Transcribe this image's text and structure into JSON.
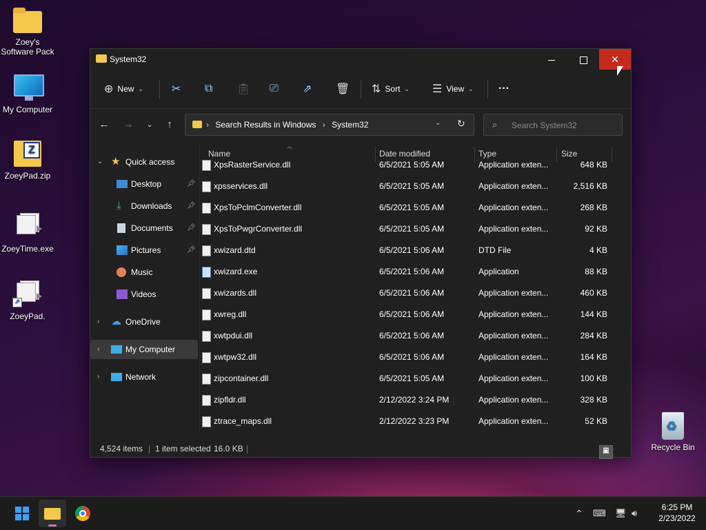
{
  "desktop": {
    "icons": [
      {
        "label": "Zoey's Software Pack",
        "icon": "folder-icon"
      },
      {
        "label": "My Computer",
        "icon": "monitor-icon"
      },
      {
        "label": "ZoeyPad.zip",
        "icon": "zip-icon"
      },
      {
        "label": "ZoeyTime.exe",
        "icon": "exe-icon"
      },
      {
        "label": "ZoeyPad.",
        "icon": "shortcut-icon"
      },
      {
        "label": "Recycle Bin",
        "icon": "recycle-bin-icon"
      }
    ]
  },
  "window": {
    "title": "System32",
    "toolbar": {
      "new_label": "New",
      "sort_label": "Sort",
      "view_label": "View",
      "more_label": "···"
    },
    "address": {
      "crumbs": [
        "Search Results in Windows",
        "System32"
      ]
    },
    "search": {
      "placeholder": "Search System32"
    },
    "sidebar": {
      "items": [
        {
          "label": "Quick access",
          "icon": "star-icon"
        },
        {
          "label": "Desktop",
          "icon": "desktop-icon"
        },
        {
          "label": "Downloads",
          "icon": "download-icon"
        },
        {
          "label": "Documents",
          "icon": "documents-icon"
        },
        {
          "label": "Pictures",
          "icon": "pictures-icon"
        },
        {
          "label": "Music",
          "icon": "music-icon"
        },
        {
          "label": "Videos",
          "icon": "videos-icon"
        },
        {
          "label": "OneDrive",
          "icon": "cloud-icon"
        },
        {
          "label": "My Computer",
          "icon": "monitor-icon"
        },
        {
          "label": "Network",
          "icon": "network-icon"
        }
      ]
    },
    "columns": {
      "name": "Name",
      "date": "Date modified",
      "type": "Type",
      "size": "Size"
    },
    "files": [
      {
        "name": "XpsRasterService.dll",
        "date": "6/5/2021 5:05 AM",
        "type": "Application exten...",
        "size": "648 KB"
      },
      {
        "name": "xpsservices.dll",
        "date": "6/5/2021 5:05 AM",
        "type": "Application exten...",
        "size": "2,516 KB"
      },
      {
        "name": "XpsToPclmConverter.dll",
        "date": "6/5/2021 5:05 AM",
        "type": "Application exten...",
        "size": "268 KB"
      },
      {
        "name": "XpsToPwgrConverter.dll",
        "date": "6/5/2021 5:05 AM",
        "type": "Application exten...",
        "size": "92 KB"
      },
      {
        "name": "xwizard.dtd",
        "date": "6/5/2021 5:06 AM",
        "type": "DTD File",
        "size": "4 KB"
      },
      {
        "name": "xwizard.exe",
        "date": "6/5/2021 5:06 AM",
        "type": "Application",
        "size": "88 KB"
      },
      {
        "name": "xwizards.dll",
        "date": "6/5/2021 5:06 AM",
        "type": "Application exten...",
        "size": "460 KB"
      },
      {
        "name": "xwreg.dll",
        "date": "6/5/2021 5:06 AM",
        "type": "Application exten...",
        "size": "144 KB"
      },
      {
        "name": "xwtpdui.dll",
        "date": "6/5/2021 5:06 AM",
        "type": "Application exten...",
        "size": "284 KB"
      },
      {
        "name": "xwtpw32.dll",
        "date": "6/5/2021 5:06 AM",
        "type": "Application exten...",
        "size": "164 KB"
      },
      {
        "name": "zipcontainer.dll",
        "date": "6/5/2021 5:05 AM",
        "type": "Application exten...",
        "size": "100 KB"
      },
      {
        "name": "zipfldr.dll",
        "date": "2/12/2022 3:24 PM",
        "type": "Application exten...",
        "size": "328 KB"
      },
      {
        "name": "ztrace_maps.dll",
        "date": "2/12/2022 3:23 PM",
        "type": "Application exten...",
        "size": "52 KB"
      }
    ],
    "status": {
      "items": "4,524 items",
      "selected": "1 item selected",
      "size": "16.0 KB"
    }
  },
  "taskbar": {
    "time": "6:25 PM",
    "date": "2/23/2022"
  }
}
